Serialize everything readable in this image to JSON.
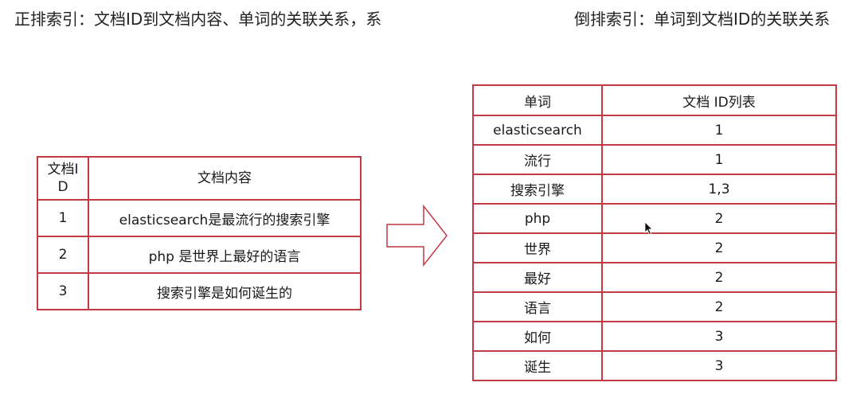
{
  "captions": {
    "forward": "正排索引：文档ID到文档内容、单词的关联关系，系",
    "inverted": "倒排索引：单词到文档ID的关联关系"
  },
  "forward_table": {
    "headers": [
      "文档ID",
      "文档内容"
    ],
    "rows": [
      {
        "id": "1",
        "content": "elasticsearch是最流行的搜索引擎"
      },
      {
        "id": "2",
        "content": "php 是世界上最好的语言"
      },
      {
        "id": "3",
        "content": "搜索引擎是如何诞生的"
      }
    ]
  },
  "inverted_table": {
    "headers": [
      "单词",
      "文档 ID列表"
    ],
    "rows": [
      {
        "term": "elasticsearch",
        "ids": "1"
      },
      {
        "term": "流行",
        "ids": "1"
      },
      {
        "term": "搜索引擎",
        "ids": "1,3"
      },
      {
        "term": "php",
        "ids": "2"
      },
      {
        "term": "世界",
        "ids": "2"
      },
      {
        "term": "最好",
        "ids": "2"
      },
      {
        "term": "语言",
        "ids": "2"
      },
      {
        "term": "如何",
        "ids": "3"
      },
      {
        "term": "诞生",
        "ids": "3"
      }
    ]
  },
  "colors": {
    "border": "#c23a44",
    "arrow": "#c23a44"
  },
  "icons": {
    "arrow": "right-arrow-icon",
    "cursor": "mouse-cursor-icon"
  }
}
